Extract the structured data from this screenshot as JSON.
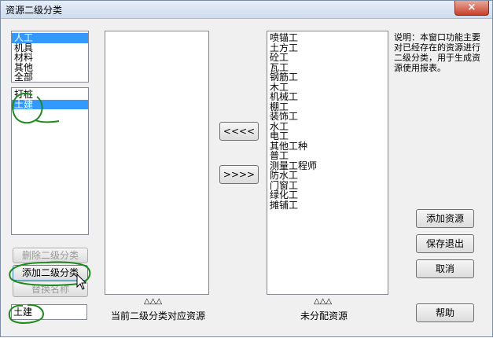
{
  "window": {
    "title": "资源二级分类",
    "close_symbol": "×"
  },
  "top_list": {
    "items": [
      "人工",
      "机具",
      "材料",
      "其他",
      "全部"
    ],
    "selected": 0
  },
  "second_list": {
    "items": [
      "打桩",
      "土建"
    ],
    "selected": 1
  },
  "buttons": {
    "delete_second": "删除二级分类",
    "add_second": "添加二级分类",
    "rename": "替换名称",
    "move_left": "<<<<",
    "move_right": ">>>>",
    "add_resource": "添加资源",
    "save_exit": "保存退出",
    "cancel": "取消",
    "help": "帮助"
  },
  "name_input": {
    "value": "土建"
  },
  "current_list": {
    "items": []
  },
  "current_caption_marks": "△△△",
  "current_caption": "当前二级分类对应资源",
  "unassigned_list": {
    "items": [
      "喷锚工",
      "土方工",
      "砼工",
      "瓦工",
      "钢筋工",
      "木工",
      "机械工",
      "棚工",
      "装饰工",
      "水工",
      "电工",
      "其他工种",
      "普工",
      "测量工程师",
      "防水工",
      "门窗工",
      "绿化工",
      "摊铺工"
    ]
  },
  "unassigned_caption_marks": "△△△",
  "unassigned_caption": "未分配资源",
  "note": "说明：本窗口功能主要对已经存在的资源进行二级分类，用于生成资源使用报表。",
  "colors": {
    "selection": "#3399ff",
    "annotation": "#1e8a1e"
  }
}
